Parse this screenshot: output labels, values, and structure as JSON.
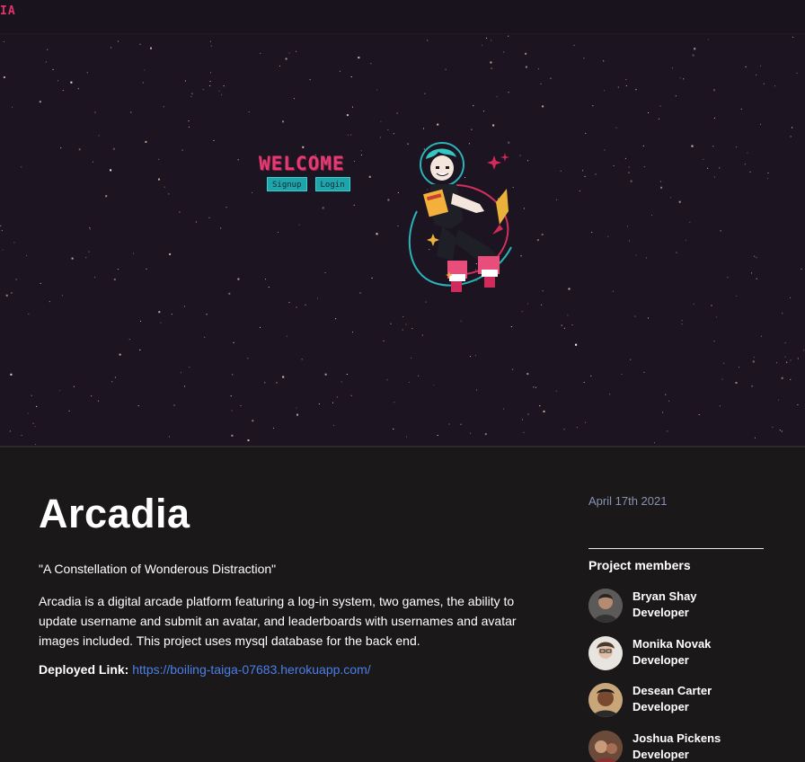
{
  "hero": {
    "logo_text": "IA",
    "welcome_title": "WELCOME",
    "signup_label": "Signup",
    "login_label": "Login",
    "accent_color": "#e23c73",
    "button_color": "#1fa4aa"
  },
  "project": {
    "title": "Arcadia",
    "tagline": "\"A Constellation of Wonderous Distraction\"",
    "description": "Arcadia is a digital arcade platform featuring a log-in system, two games, the ability to update username and submit an avatar, and leaderboards with usernames and avatar images included. This project uses mysql database for the back end.",
    "deployed_label": "Deployed Link:",
    "deployed_url": "https://boiling-taiga-07683.herokuapp.com/"
  },
  "sidebar": {
    "date": "April 17th 2021",
    "members_heading": "Project members",
    "members": [
      {
        "name": "Bryan Shay",
        "role": "Developer",
        "avatar": "avatar-photo"
      },
      {
        "name": "Monika Novak",
        "role": "Developer",
        "avatar": "avatar-photo"
      },
      {
        "name": "Desean Carter",
        "role": "Developer",
        "avatar": "avatar-photo"
      },
      {
        "name": "Joshua Pickens",
        "role": "Developer",
        "avatar": "avatar-photo"
      }
    ]
  }
}
